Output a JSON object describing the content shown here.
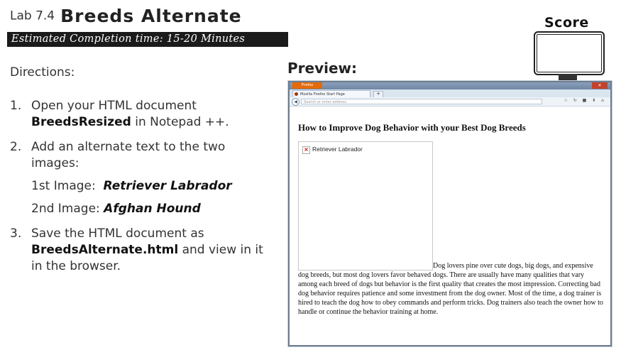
{
  "header": {
    "lab_number": "Lab 7.4",
    "lab_name": "Breeds Alternate",
    "estimated_time": "Estimated Completion time: 15-20 Minutes"
  },
  "directions_label": "Directions:",
  "steps": [
    {
      "num": "1.",
      "pre": "Open your HTML document ",
      "bold": "BreedsResized",
      "post": " in Notepad ++."
    },
    {
      "num": "2.",
      "text": "Add an alternate text to the two images:",
      "images": [
        {
          "label": "1st Image:",
          "value": "Retriever Labrador"
        },
        {
          "label": "2nd Image:",
          "value": "Afghan Hound"
        }
      ]
    },
    {
      "num": "3.",
      "pre": "Save the HTML document as ",
      "bold": "BreedsAlternate.html",
      "post": " and view in it in the browser."
    }
  ],
  "preview_label": "Preview:",
  "score_label": "Score",
  "browser": {
    "firefox_button": "Firefox",
    "tab_title": "Mozilla Firefox Start Page",
    "url_placeholder": "Search or enter address",
    "new_tab": "+",
    "page_heading": "How to Improve Dog Behavior with your Best Dog Breeds",
    "image_alt": "Retriever Labrador",
    "paragraph": "Dog lovers pine over cute dogs, big dogs, and expensive dog breeds, but most dog lovers favor behaved dogs. There are usually have many qualities that vary among each breed of dogs but behavior is the first quality that creates the most impression. Correcting bad dog behavior requires patience and some investment from the dog owner. Most of the time, a dog trainer is hired to teach the dog how to obey commands and perform tricks. Dog trainers also teach the owner how to handle or continue the behavior training at home."
  }
}
